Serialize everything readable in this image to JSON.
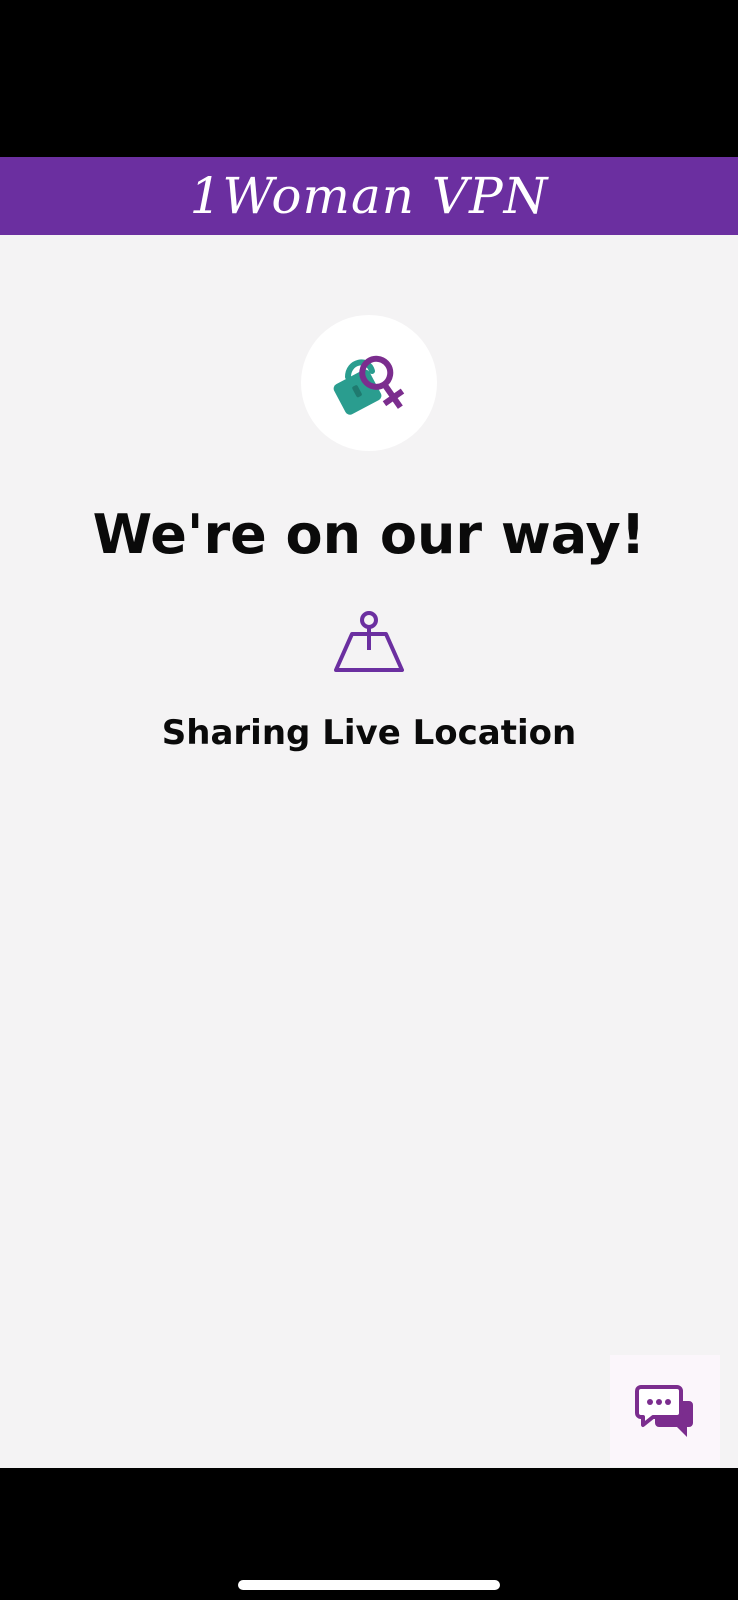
{
  "app": {
    "title": "1Woman VPN"
  },
  "main": {
    "headline": "We're on our way!",
    "status": "Sharing Live Location"
  },
  "icons": {
    "logo": "lock-female-symbol-icon",
    "location": "map-pin-icon",
    "chat": "chat-bubbles-icon"
  },
  "colors": {
    "brand_purple": "#6b2fa0",
    "lock_teal": "#2a9d8f",
    "background": "#f4f3f4"
  }
}
